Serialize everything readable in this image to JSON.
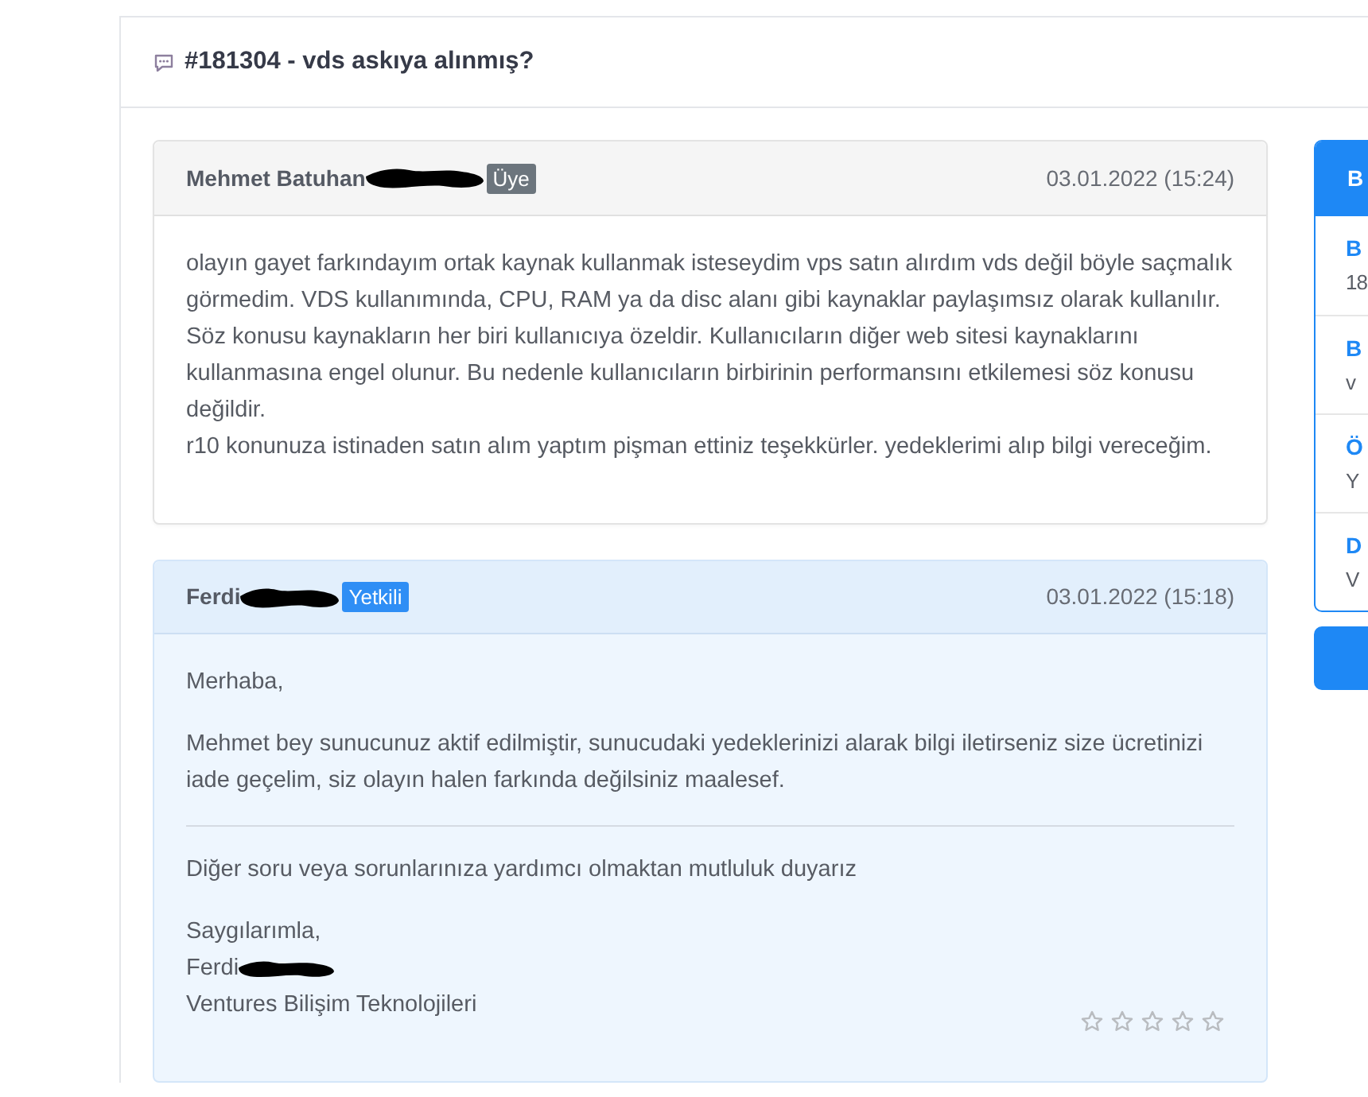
{
  "ticket": {
    "title": "#181304 - vds askıya alınmış?"
  },
  "messages": [
    {
      "kind": "customer",
      "author": "Mehmet Batuhan",
      "redacted": true,
      "badge": "Üye",
      "date": "03.01.2022 (15:24)",
      "body": [
        {
          "kind": "paragraph",
          "lines": [
            "olayın gayet farkındayım ortak kaynak kullanmak isteseydim vps satın alırdım vds değil böyle saçmalık görmedim. VDS kullanımında, CPU, RAM ya da disc alanı gibi kaynaklar paylaşımsız olarak kullanılır. Söz konusu kaynakların her biri kullanıcıya özeldir. Kullanıcıların diğer web sitesi kaynaklarını kullanmasına engel olunur. Bu nedenle kullanıcıların birbirinin performansını etkilemesi söz konusu değildir.",
            "r10 konunuza istinaden satın alım yaptım pişman ettiniz teşekkürler. yedeklerimi alıp bilgi vereceğim."
          ]
        }
      ]
    },
    {
      "kind": "staff",
      "author": "Ferdi",
      "redacted": true,
      "badge": "Yetkili",
      "date": "03.01.2022 (15:18)",
      "body": [
        {
          "kind": "paragraph",
          "lines": [
            "Merhaba,"
          ]
        },
        {
          "kind": "paragraph",
          "lines": [
            "Mehmet bey sunucunuz aktif edilmiştir, sunucudaki yedeklerinizi alarak bilgi iletirseniz size ücretinizi iade geçelim, siz olayın halen farkında değilsiniz maalesef."
          ]
        },
        {
          "kind": "divider"
        },
        {
          "kind": "paragraph",
          "lines": [
            "Diğer soru veya sorunlarınıza yardımcı olmaktan mutluluk duyarız"
          ]
        },
        {
          "kind": "signature",
          "lines": [
            {
              "text": "Saygılarımla,",
              "redacted": false
            },
            {
              "text": "Ferdi",
              "redacted": true
            },
            {
              "text": "Ventures Bilişim Teknolojileri",
              "redacted": false
            }
          ]
        }
      ],
      "stars": 0
    }
  ],
  "sidebar": {
    "title": "B",
    "items": [
      {
        "label": "B",
        "value": "18"
      },
      {
        "label": "B",
        "value": "v"
      },
      {
        "label": "Ö",
        "value": "Y"
      },
      {
        "label": "D",
        "value": "V"
      }
    ]
  }
}
